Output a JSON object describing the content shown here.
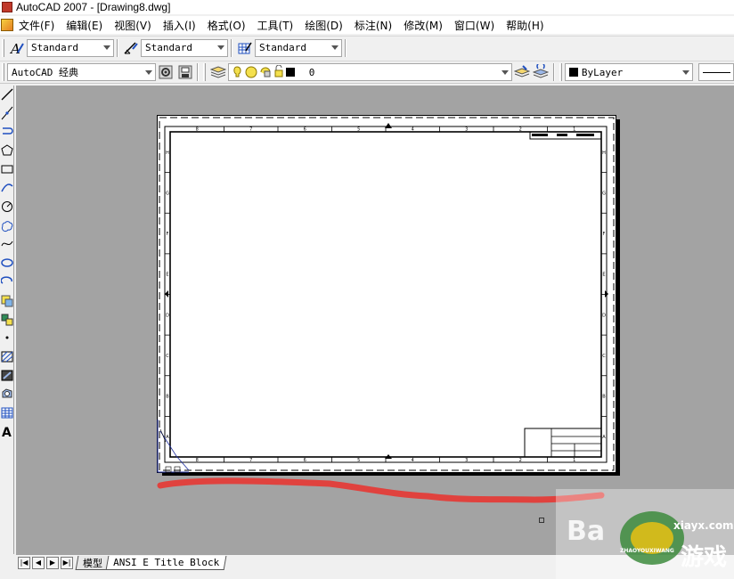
{
  "window": {
    "title": "AutoCAD 2007 - [Drawing8.dwg]"
  },
  "menu": [
    "文件(F)",
    "编辑(E)",
    "视图(V)",
    "插入(I)",
    "格式(O)",
    "工具(T)",
    "绘图(D)",
    "标注(N)",
    "修改(M)",
    "窗口(W)",
    "帮助(H)"
  ],
  "styles_toolbar": {
    "text_style": "Standard",
    "dim_style": "Standard",
    "table_style": "Standard"
  },
  "workspace_toolbar": {
    "workspace": "AutoCAD 经典",
    "layer": "0",
    "color": "ByLayer"
  },
  "drawing": {
    "border_numbers_top": [
      "8",
      "7",
      "6",
      "5",
      "4",
      "3",
      "2",
      "1"
    ],
    "border_numbers_bottom": [
      "8",
      "7",
      "6",
      "5",
      "4",
      "3",
      "2",
      "1"
    ],
    "border_letters_right": [
      "H",
      "G",
      "F",
      "E",
      "D",
      "C",
      "B",
      "A"
    ]
  },
  "tabs": {
    "model": "模型",
    "layout": "ANSI E Title Block"
  },
  "watermark": {
    "brand": "Ba",
    "site": "xiayx.com",
    "name": "游戏",
    "pinyin": "ZHAOYOUXIWANG"
  },
  "colors": {
    "canvas": "#a3a3a3",
    "annotation": "#e53935"
  }
}
